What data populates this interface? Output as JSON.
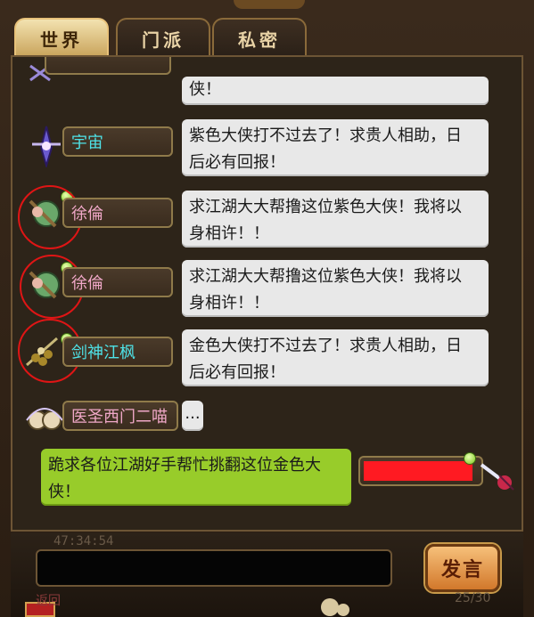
{
  "tabs": [
    {
      "label": "世界",
      "active": true
    },
    {
      "label": "门派",
      "active": false
    },
    {
      "label": "私密",
      "active": false
    }
  ],
  "messages": [
    {
      "name": "",
      "text": "侠！"
    },
    {
      "name": "宇宙",
      "text_line1": "紫色大侠打不过去了！求贵人相助，日",
      "text_line2": "后必有回报！"
    },
    {
      "name": "徐倫",
      "text_line1": "求江湖大大帮撸这位紫色大侠！我将以",
      "text_line2": "身相许！！"
    },
    {
      "name": "徐倫",
      "text_line1": "求江湖大大帮撸这位紫色大侠！我将以",
      "text_line2": "身相许！！"
    },
    {
      "name": "剑神江枫",
      "text_line1": "金色大侠打不过去了！求贵人相助，日",
      "text_line2": "后必有回报！"
    },
    {
      "name": "医圣西门二喵",
      "text": "..."
    }
  ],
  "self_message": {
    "text_line1": "跪求各位江湖好手帮忙挑翻这位金色大",
    "text_line2": "侠！"
  },
  "timestamp": "47:34:54",
  "input": {
    "value": "",
    "placeholder": ""
  },
  "send_button": "发言",
  "page_count": "25/30",
  "bottom_label": "返回",
  "colors": {
    "name_cyan": "#4ee3e8",
    "name_pink": "#f0a8c8",
    "self_bubble": "#98cc2a",
    "highlight": "#e01515"
  }
}
